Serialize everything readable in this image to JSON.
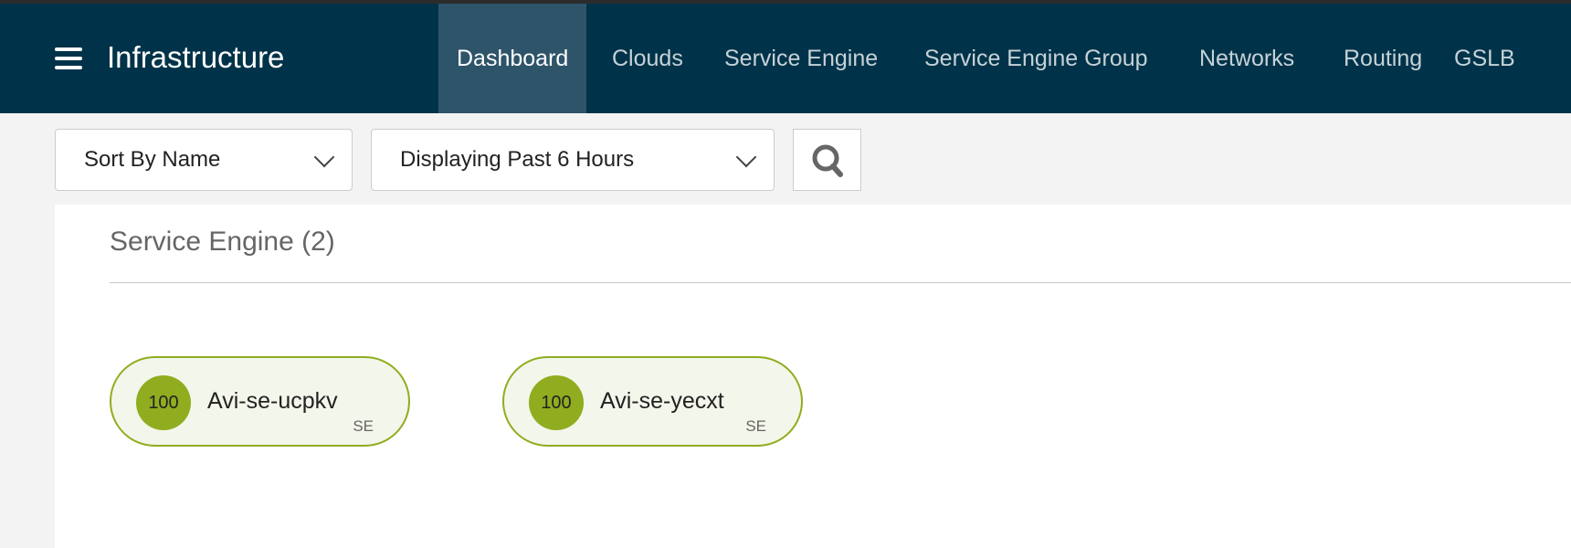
{
  "header": {
    "title": "Infrastructure",
    "tabs": [
      {
        "label": "Dashboard",
        "active": true
      },
      {
        "label": "Clouds"
      },
      {
        "label": "Service Engine"
      },
      {
        "label": "Service Engine Group"
      },
      {
        "label": "Networks"
      },
      {
        "label": "Routing"
      },
      {
        "label": "GSLB"
      }
    ]
  },
  "toolbar": {
    "sort": "Sort By Name",
    "time": "Displaying Past 6 Hours"
  },
  "section": {
    "title": "Service Engine (2)",
    "items": [
      {
        "score": "100",
        "name": "Avi-se-ucpkv",
        "type": "SE"
      },
      {
        "score": "100",
        "name": "Avi-se-yecxt",
        "type": "SE"
      }
    ]
  },
  "colors": {
    "nav": "#003349",
    "active_tab": "#2e5469",
    "health_good": "#8fad1f"
  }
}
